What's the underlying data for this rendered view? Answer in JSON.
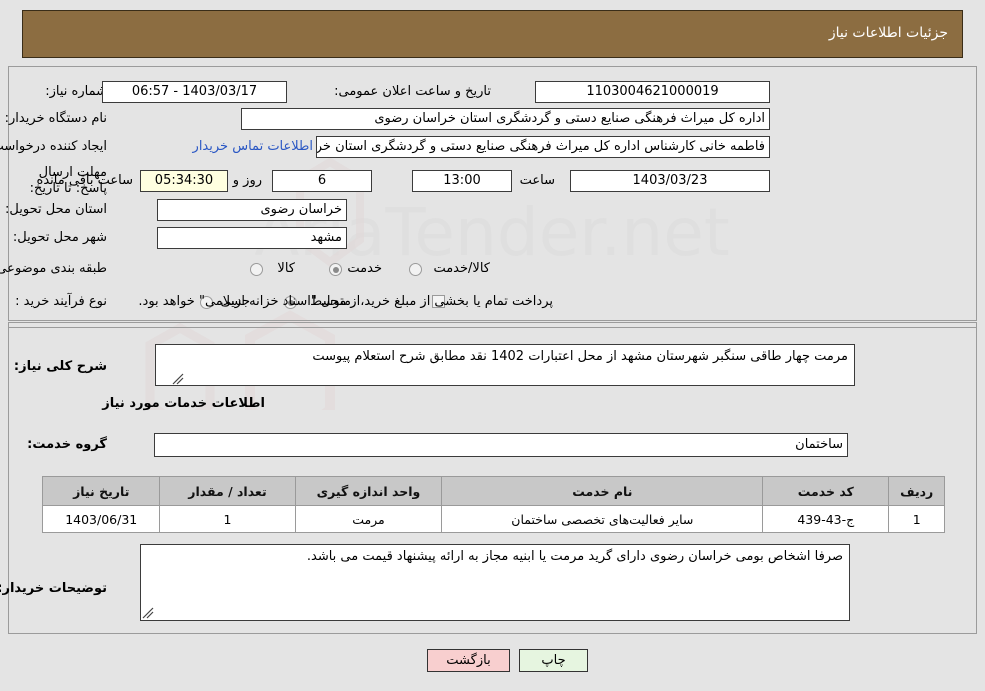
{
  "header": {
    "title": "جزئیات اطلاعات نیاز"
  },
  "form": {
    "need_number_label": "شماره نیاز:",
    "need_number_value": "1103004621000019",
    "announce_datetime_label": "تاریخ و ساعت اعلان عمومی:",
    "announce_datetime_value": "1403/03/17 - 06:57",
    "buyer_org_label": "نام دستگاه خریدار:",
    "buyer_org_value": "اداره کل میراث فرهنگی  صنایع دستی و گردشگری استان خراسان رضوی",
    "requester_label": "ایجاد کننده درخواست:",
    "requester_value": "فاطمه خانی کارشناس اداره کل میراث فرهنگی  صنایع دستی و گردشگری استان خراسان رضوی",
    "contact_link": "اطلاعات تماس خریدار",
    "deadline_label": "مهلت ارسال پاسخ: تا تاریخ:",
    "deadline_date": "1403/03/23",
    "deadline_hour_label": "ساعت",
    "deadline_hour": "13:00",
    "remaining_days": "6",
    "remaining_days_label": "روز و",
    "remaining_time": "05:34:30",
    "remaining_time_label": "ساعت باقی مانده",
    "province_label": "استان محل تحویل:",
    "province_value": "خراسان رضوی",
    "city_label": "شهر محل تحویل:",
    "city_value": "مشهد",
    "category_label": "طبقه بندی موضوعی:",
    "category_options": [
      {
        "label": "کالا",
        "selected": false
      },
      {
        "label": "خدمت",
        "selected": true
      },
      {
        "label": "کالا/خدمت",
        "selected": false
      }
    ],
    "purchase_type_label": "نوع فرآیند خرید :",
    "purchase_type_options": [
      {
        "label": "جزیی",
        "selected": false
      },
      {
        "label": "متوسط",
        "selected": true
      }
    ],
    "treasury_checkbox_checked": false,
    "treasury_note": "پرداخت تمام یا بخشی از مبلغ خرید،از محل \"اسناد خزانه اسلامی\" خواهد بود."
  },
  "summary": {
    "label": "شرح کلی نیاز:",
    "value": "مرمت چهار طاقی سنگبر شهرستان مشهد از محل اعتبارات 1402 نقد مطابق شرح استعلام پیوست"
  },
  "services": {
    "section_title": "اطلاعات خدمات مورد نیاز",
    "group_label": "گروه خدمت:",
    "group_value": "ساختمان",
    "table": {
      "columns": [
        "ردیف",
        "کد خدمت",
        "نام خدمت",
        "واحد اندازه گیری",
        "تعداد / مقدار",
        "تاریخ نیاز"
      ],
      "rows": [
        {
          "row_no": "1",
          "service_code": "ج-43-439",
          "service_name": "سایر فعالیت‌های تخصصی ساختمان",
          "unit": "مرمت",
          "quantity": "1",
          "need_date": "1403/06/31"
        }
      ]
    }
  },
  "buyer_notes": {
    "label": "توضیحات خریدار:",
    "value": "صرفا اشخاص بومی خراسان رضوی دارای گرید مرمت یا ابنیه مجاز به ارائه پیشنهاد قیمت می باشد."
  },
  "footer": {
    "back_button": "بازگشت",
    "print_button": "چاپ"
  },
  "watermark": {
    "text": "AriaTender.net"
  },
  "colors": {
    "header_bg": "#8c6d41",
    "page_bg": "#e4e4e4",
    "link": "#2a57c4",
    "table_header_bg": "#c8c8c8",
    "back_button_bg": "#f8cfcf",
    "print_button_bg": "#e6f5e0",
    "highlight_field_bg": "#ffffe0"
  }
}
